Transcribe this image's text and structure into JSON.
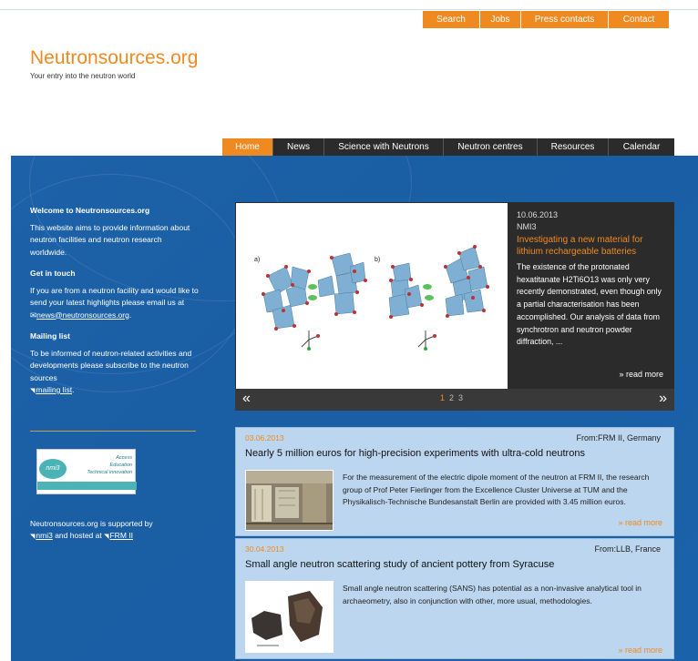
{
  "top_nav": {
    "search": "Search",
    "jobs": "Jobs",
    "press": "Press contacts",
    "contact": "Contact"
  },
  "site": {
    "name": "Neutronsources.org",
    "tagline": "Your entry into the neutron world"
  },
  "main_nav": [
    "Home",
    "News",
    "Science with Neutrons",
    "Neutron centres",
    "Resources",
    "Calendar"
  ],
  "sidebar": {
    "welcome_title": "Welcome to Neutronsources.org",
    "welcome_text": "This website aims to provide information about neutron facilities and neutron research worldwide.",
    "contact_title": "Get in touch",
    "contact_text": "If you are from a neutron facility and would like to send your latest highlights please email us at",
    "email": "news@neutronsources.org",
    "mailing_title": "Mailing list",
    "mailing_text": "To be informed of neutron-related activities and developments please subscribe to the neutron sources",
    "mailing_link": "mailing list",
    "fp7_label": "nmi3",
    "fp7_tag1": "Access",
    "fp7_tag2": "Education",
    "fp7_tag3": "Technical innovation",
    "support_text1": "Neutronsources.org is supported by",
    "support_link1": "nmi3",
    "support_text2": "and hosted at",
    "support_link2": "FRM II"
  },
  "slider": {
    "date": "10.06.2013",
    "category": "NMI3",
    "title": "Investigating a new material for lithium rechargeable batteries",
    "body": "The existence of the protonated hexatitanate H2Ti6O13 was only very recently demonstrated, even though only a partial characterisation has been accomplished. Our analysis of data from synchrotron and neutron powder diffraction, ...",
    "read_more": "» read more",
    "prev": "«",
    "next": "»",
    "pages": [
      "1",
      "2",
      "3"
    ],
    "image_labels": [
      "a)",
      "b)"
    ]
  },
  "news": [
    {
      "date": "03.06.2013",
      "from_label": "From:",
      "from": "FRM II, Germany",
      "title": "Nearly 5 million euros for high-precision experiments with ultra-cold neutrons",
      "body": "For the measurement of the electric dipole moment of the neutron at FRM II, the research group of Prof Peter Fierlinger from the Excellence Cluster Universe at TUM and the Physikalisch-Technische Bundesanstalt Berlin are provided with 3.45 million euros.",
      "more": "» read more"
    },
    {
      "date": "30.04.2013",
      "from_label": "From:",
      "from": "LLB, France",
      "title": "Small angle neutron scattering study of ancient pottery from Syracuse",
      "body": "Small angle neutron scattering (SANS) has potential as a non-invasive analytical tool in archaeometry, also in conjunction with other, more usual, methodologies.",
      "more": "» read more"
    }
  ],
  "colors": {
    "accent": "#ef8a21",
    "blue": "#1d62a8",
    "dark": "#2b2b2b",
    "news_bg": "#bcd6ef"
  }
}
